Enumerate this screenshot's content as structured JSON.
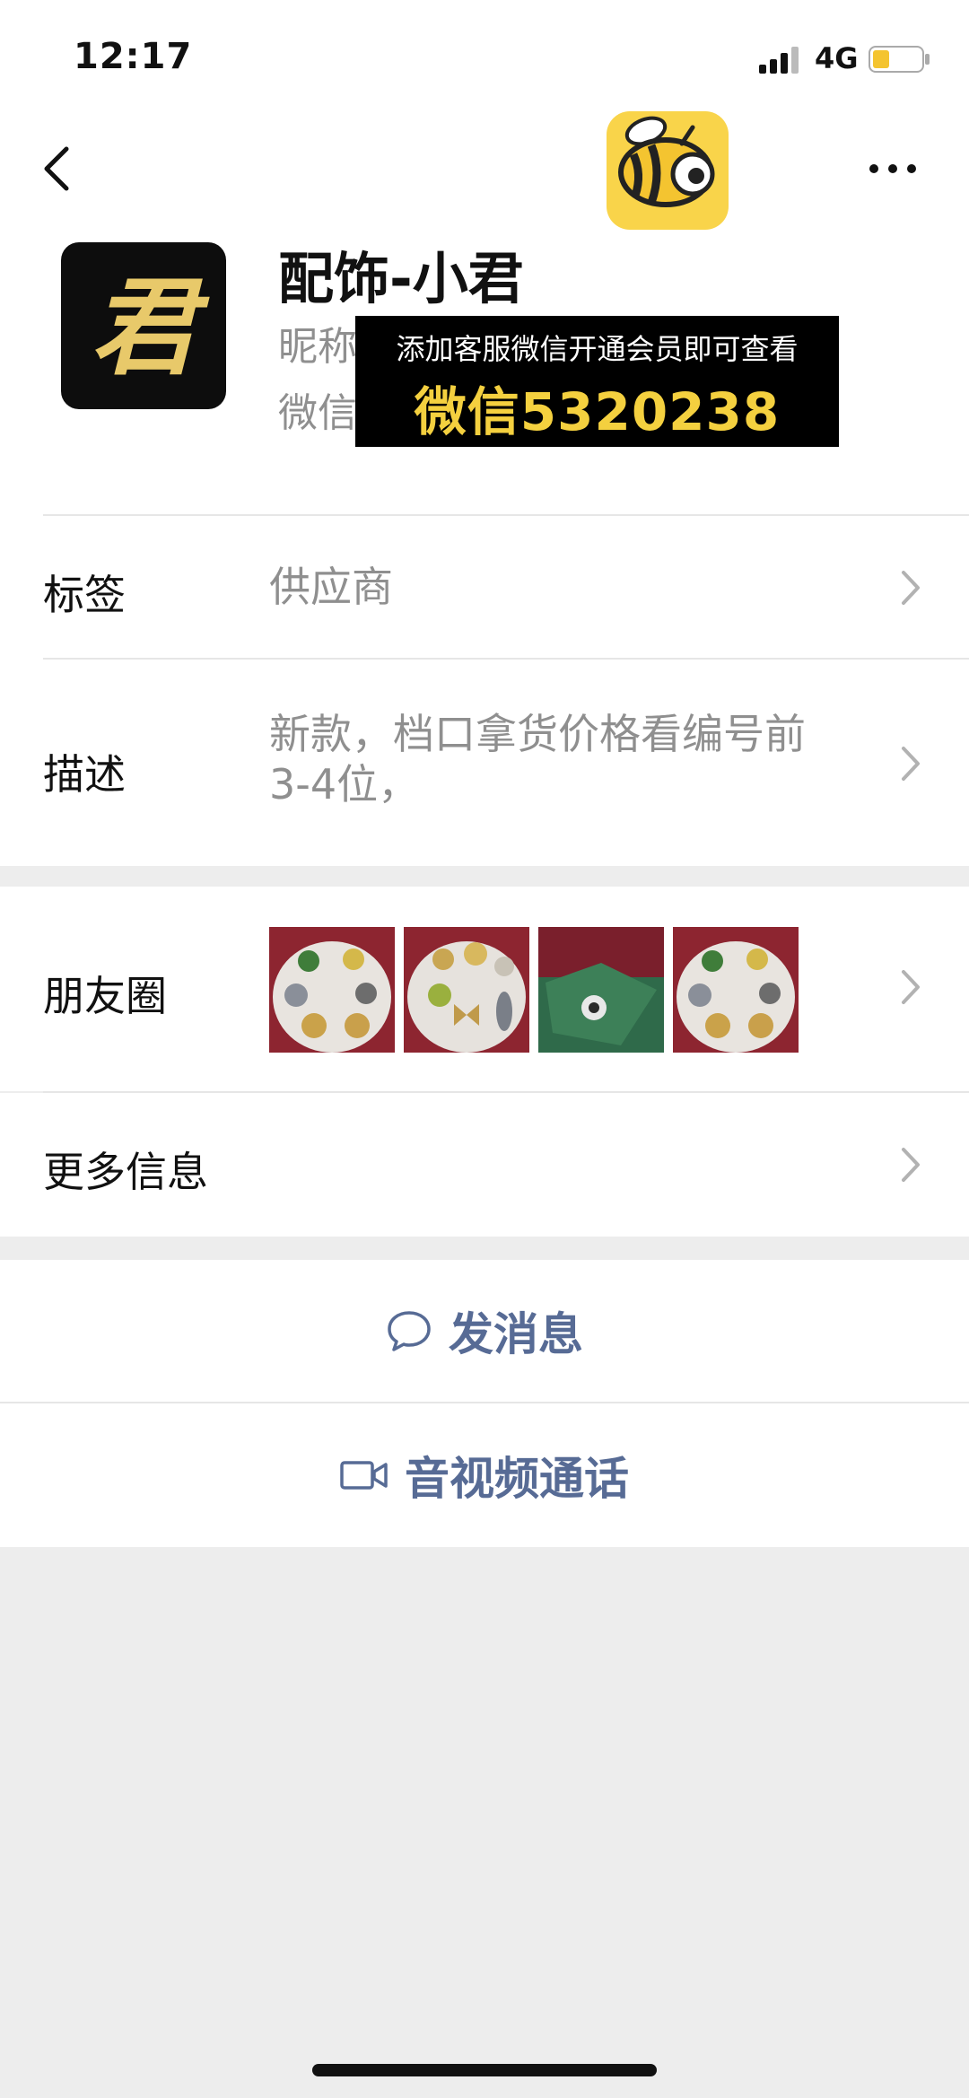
{
  "status_bar": {
    "time": "12:17",
    "network": "4G",
    "battery_level": 0.35
  },
  "profile": {
    "name": "配饰-小君",
    "nickname_label": "昵称",
    "wechat_label": "微信",
    "avatar_char": "君"
  },
  "overlay": {
    "line1": "添加客服微信开通会员即可查看",
    "line2": "微信5320238"
  },
  "rows": {
    "tag_label": "标签",
    "tag_value": "供应商",
    "desc_label": "描述",
    "desc_line1": "新款，档口拿货价格看编号前",
    "desc_line2": "3-4位，",
    "moments_label": "朋友圈",
    "more_label": "更多信息"
  },
  "actions": {
    "message_label": "发消息",
    "call_label": "音视频通话"
  },
  "colors": {
    "link_blue": "#576b95",
    "secondary_text": "#8f8f8f",
    "banner_yellow": "#f4d03f",
    "logo_yellow": "#f9d44a"
  }
}
